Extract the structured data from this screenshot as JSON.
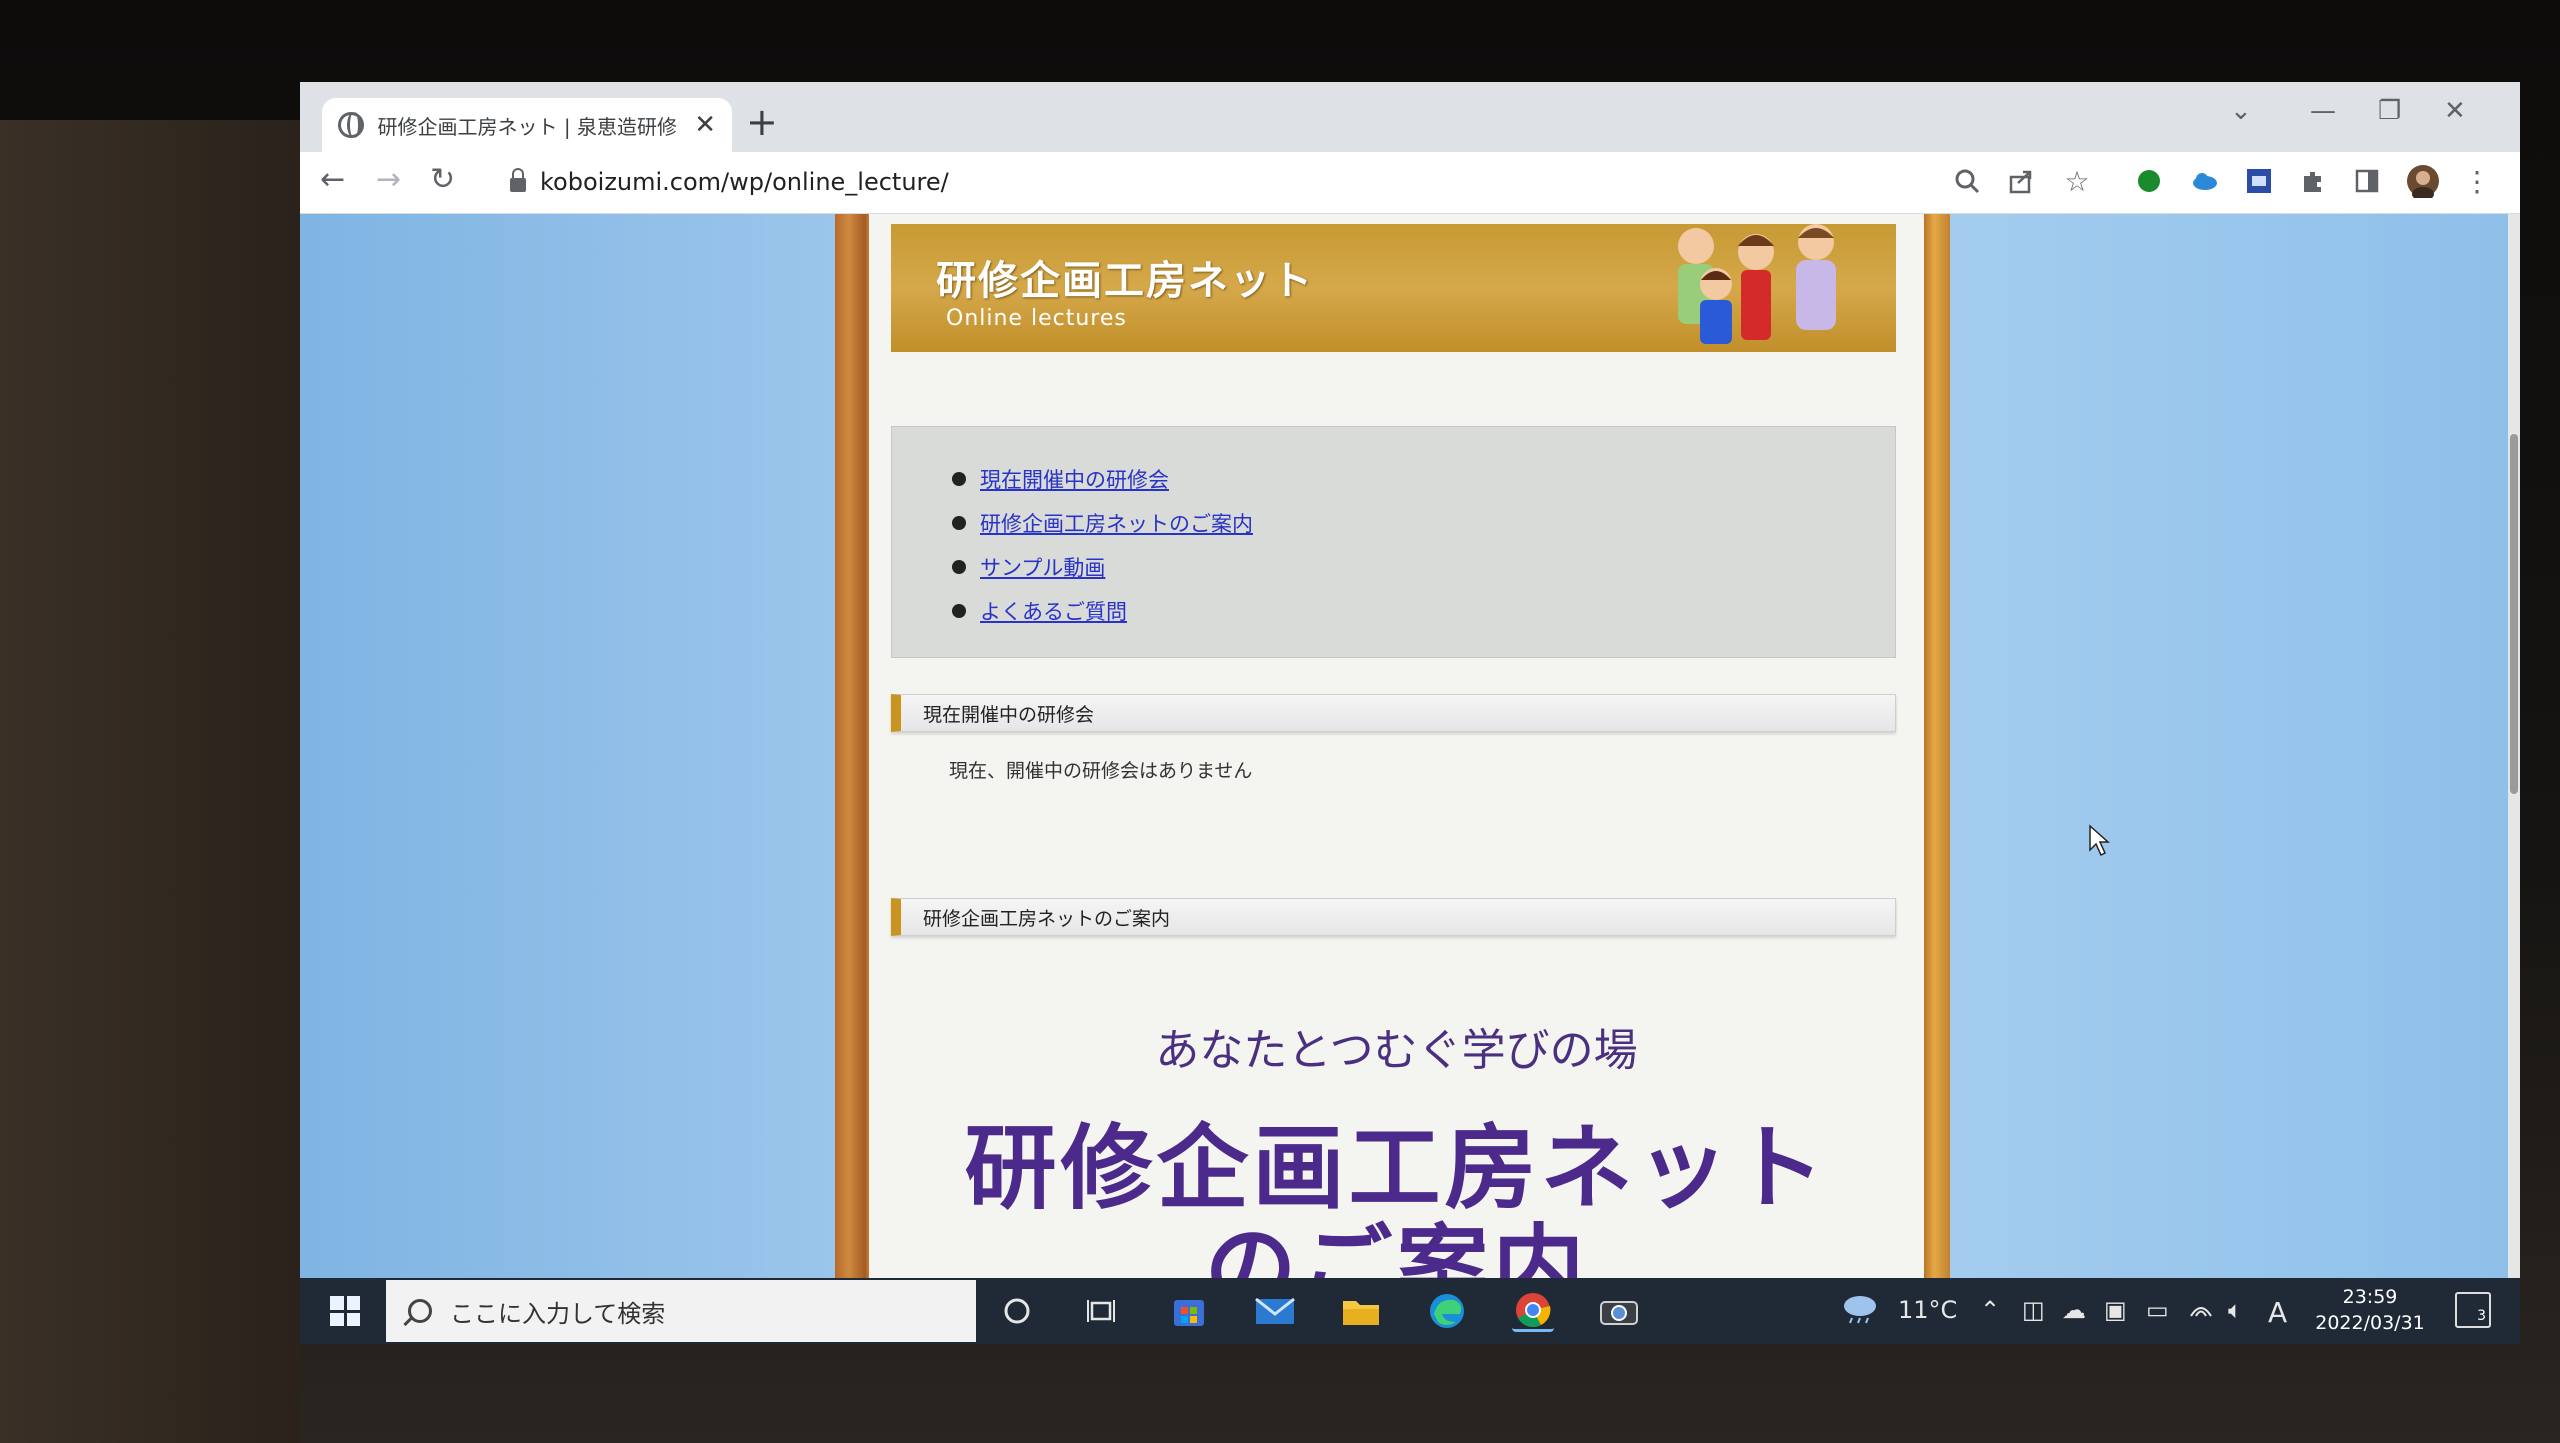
{
  "browser": {
    "tab_title": "研修企画工房ネット | 泉恵造研修",
    "tab_close": "✕",
    "new_tab": "+",
    "url": "koboizumi.com/wp/online_lecture/",
    "nav": {
      "back": "←",
      "forward": "→",
      "reload": "↻"
    },
    "window_controls": {
      "dropdown": "⌄",
      "minimize": "—",
      "restore": "❐",
      "close": "✕"
    }
  },
  "site": {
    "banner_title": "研修企画工房ネット",
    "banner_subtitle": "Online lectures",
    "menu": [
      {
        "label": "現在開催中の研修会"
      },
      {
        "label": "研修企画工房ネットのご案内"
      },
      {
        "label": "サンプル動画"
      },
      {
        "label": "よくあるご質問"
      }
    ],
    "section_current": {
      "heading": "現在開催中の研修会",
      "text": "現在、開催中の研修会はありません"
    },
    "section_intro": {
      "heading": "研修企画工房ネットのご案内",
      "catch": "あなたとつむぐ学びの場",
      "title_line1": "研修企画工房ネット",
      "title_line2": "のご案内"
    }
  },
  "taskbar": {
    "search_placeholder": "ここに入力して検索",
    "weather_temp": "11°C",
    "ime": "A",
    "time": "23:59",
    "date": "2022/03/31",
    "notification_count": "3"
  },
  "colors": {
    "banner_gold": "#c79a34",
    "link_blue": "#2a33c8",
    "title_purple": "#4c2a8c",
    "section_accent": "#c99520"
  }
}
